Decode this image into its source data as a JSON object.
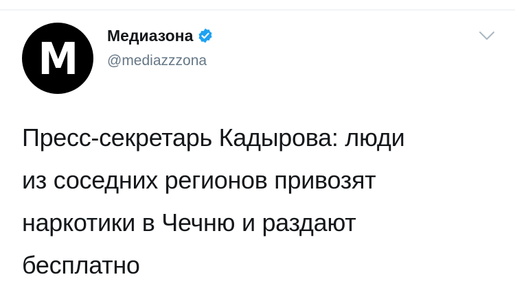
{
  "account": {
    "display_name": "Медиазона",
    "handle": "@mediazzzona",
    "avatar_letter": "M",
    "verified": true,
    "verified_color": "#1da1f2"
  },
  "tweet": {
    "lines": [
      "Пресс-секретарь Кадырова: люди",
      "из соседних регионов привозят",
      "наркотики в Чечню и раздают",
      "бесплатно"
    ]
  },
  "icons": {
    "verified": "verified-badge-icon",
    "menu": "chevron-down-icon"
  },
  "colors": {
    "text": "#14171a",
    "secondary": "#657786",
    "caret": "#aab8c2"
  }
}
